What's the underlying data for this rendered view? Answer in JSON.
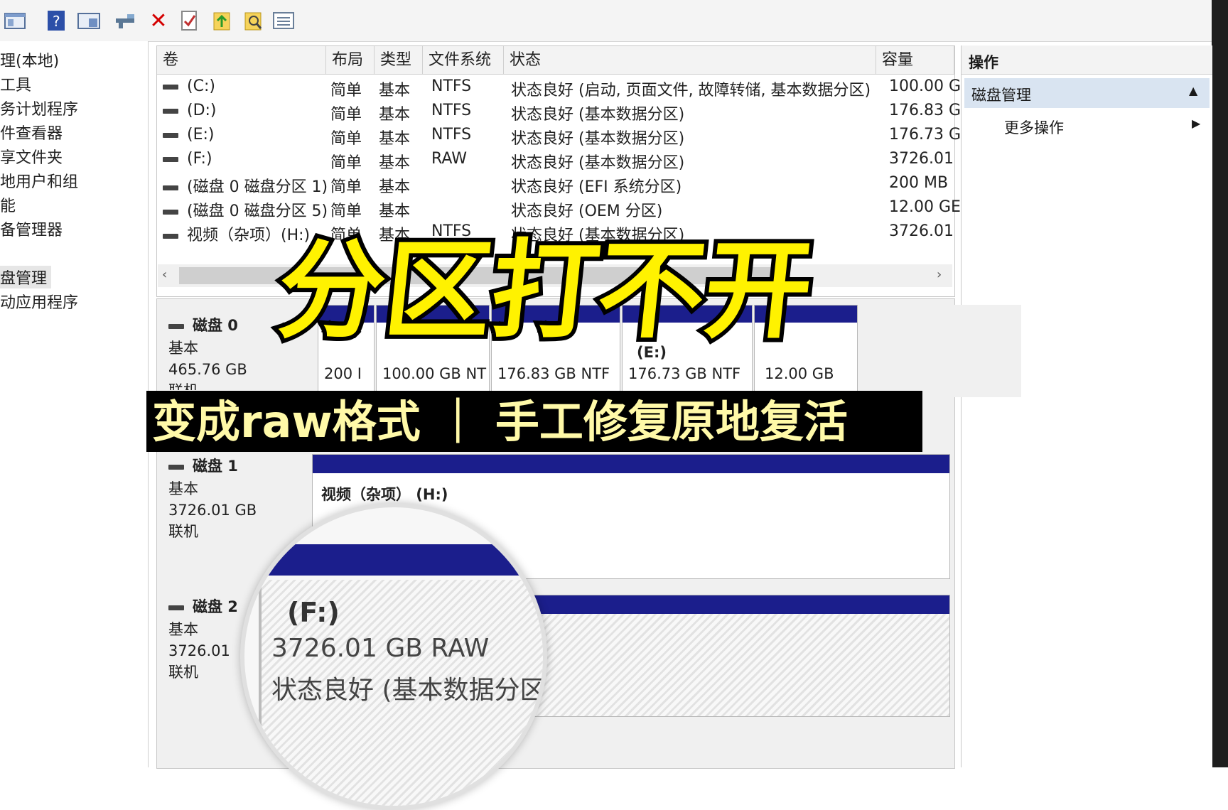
{
  "toolbar": {
    "icons": [
      "window-icon",
      "help-icon",
      "properties-icon",
      "connect-icon",
      "delete-icon",
      "check-icon",
      "import-icon",
      "search-icon",
      "list-icon"
    ],
    "delete_color": "#d40000"
  },
  "tree": {
    "items": [
      "理(本地)",
      "工具",
      "务计划程序",
      "件查看器",
      "享文件夹",
      "地用户和组",
      "能",
      "备管理器",
      "盘管理",
      "动应用程序"
    ]
  },
  "volumes": {
    "headers": [
      "卷",
      "布局",
      "类型",
      "文件系统",
      "状态",
      "容量"
    ],
    "rows": [
      {
        "name": "(C:)",
        "layout": "简单",
        "type": "基本",
        "fs": "NTFS",
        "status": "状态良好 (启动, 页面文件, 故障转储, 基本数据分区)",
        "capacity": "100.00 G"
      },
      {
        "name": "(D:)",
        "layout": "简单",
        "type": "基本",
        "fs": "NTFS",
        "status": "状态良好 (基本数据分区)",
        "capacity": "176.83 G"
      },
      {
        "name": "(E:)",
        "layout": "简单",
        "type": "基本",
        "fs": "NTFS",
        "status": "状态良好 (基本数据分区)",
        "capacity": "176.73 G"
      },
      {
        "name": "(F:)",
        "layout": "简单",
        "type": "基本",
        "fs": "RAW",
        "status": "状态良好 (基本数据分区)",
        "capacity": "3726.01"
      },
      {
        "name": "(磁盘 0 磁盘分区 1)",
        "layout": "简单",
        "type": "基本",
        "fs": "",
        "status": "状态良好 (EFI 系统分区)",
        "capacity": "200 MB"
      },
      {
        "name": "(磁盘 0 磁盘分区 5)",
        "layout": "简单",
        "type": "基本",
        "fs": "",
        "status": "状态良好 (OEM 分区)",
        "capacity": "12.00 GE"
      },
      {
        "name": "视频（杂项）(H:)",
        "layout": "简单",
        "type": "基本",
        "fs": "NTFS",
        "status": "状态良好 (基本数据分区)",
        "capacity": "3726.01"
      }
    ]
  },
  "actions": {
    "title": "操作",
    "section": "磁盘管理",
    "more": "更多操作"
  },
  "disks": [
    {
      "name": "磁盘 0",
      "type": "基本",
      "size": "465.76 GB",
      "state": "联机",
      "partitions": [
        "200 I",
        "100.00 GB NT",
        "176.83 GB NTF",
        "176.73 GB NTF",
        "12.00 GB"
      ],
      "e_label": "(E:)"
    },
    {
      "name": "磁盘 1",
      "type": "基本",
      "size": "3726.01 GB",
      "state": "联机",
      "partitions": [
        "视频（杂项） (H:)"
      ]
    },
    {
      "name": "磁盘 2",
      "type": "基本",
      "size": "3726.01",
      "state": "联机"
    }
  ],
  "magnifier": {
    "label": "(F:)",
    "size": "3726.01 GB RAW",
    "status": "状态良好 (基本数据分区"
  },
  "overlay": {
    "title": "分区打不开",
    "subtitle": "变成raw格式 ｜ 手工修复原地复活",
    "title_color": "#fff200",
    "subtitle_color": "#fff9a8"
  }
}
